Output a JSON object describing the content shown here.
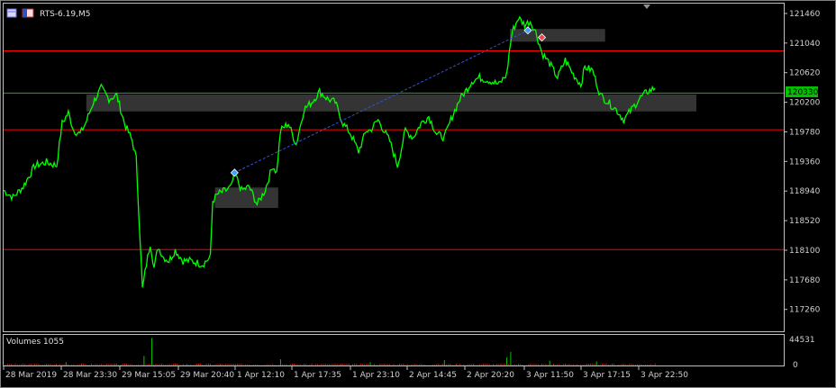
{
  "window": {
    "symbol_title": "RTS-6.19,M5",
    "volumes_label": "Volumes 1055",
    "current_price": "120330"
  },
  "colors": {
    "background": "#000000",
    "price_line": "#00ff00",
    "level_line": "#ff0000",
    "current_price_line": "#00c000",
    "zone_fill": "#3a3a3a",
    "volume_bars": "#cc2200",
    "axis_text": "#d0d0d0",
    "frame": "#c0c0c0",
    "trend_line": "#3355cc"
  },
  "chart_data": {
    "type": "line",
    "title": "RTS-6.19,M5",
    "x_tick_labels": [
      "28 Mar 2019",
      "28 Mar 23:30",
      "29 Mar 15:05",
      "29 Mar 20:40",
      "1 Apr 12:10",
      "1 Apr 17:35",
      "1 Apr 23:10",
      "2 Apr 14:45",
      "2 Apr 20:20",
      "3 Apr 11:50",
      "3 Apr 17:15",
      "3 Apr 22:50"
    ],
    "y_tick_labels": [
      "121460",
      "121040",
      "120620",
      "120200",
      "119780",
      "119360",
      "118940",
      "118520",
      "118100",
      "117680",
      "117260"
    ],
    "ylim": [
      116950,
      121600
    ],
    "current_price": 120330,
    "horizontal_levels": [
      120930,
      119810,
      118110
    ],
    "zones": [
      {
        "x_start": 0.106,
        "x_end": 0.888,
        "y_low": 120070,
        "y_high": 120310
      },
      {
        "x_start": 0.271,
        "x_end": 0.352,
        "y_low": 118700,
        "y_high": 118990
      },
      {
        "x_start": 0.649,
        "x_end": 0.771,
        "y_low": 121060,
        "y_high": 121240
      }
    ],
    "trend_line": {
      "x_start": 0.296,
      "y_start": 119200,
      "x_end": 0.672,
      "y_end": 121220
    },
    "series": [
      {
        "x": [
          0.0,
          0.012,
          0.025,
          0.04,
          0.055,
          0.068,
          0.075,
          0.083,
          0.09,
          0.098,
          0.105,
          0.115,
          0.125,
          0.135,
          0.145,
          0.155,
          0.165,
          0.17,
          0.178,
          0.183,
          0.188,
          0.193,
          0.198,
          0.205,
          0.212,
          0.22,
          0.23,
          0.24,
          0.255,
          0.265,
          0.268,
          0.275,
          0.285,
          0.292,
          0.296,
          0.305,
          0.315,
          0.325,
          0.335,
          0.345,
          0.35,
          0.355,
          0.365,
          0.375,
          0.385,
          0.395,
          0.405,
          0.415,
          0.425,
          0.435,
          0.445,
          0.455,
          0.465,
          0.47,
          0.48,
          0.495,
          0.505,
          0.515,
          0.525,
          0.535,
          0.545,
          0.555,
          0.565,
          0.575,
          0.585,
          0.595,
          0.6,
          0.61,
          0.625,
          0.635,
          0.645,
          0.648,
          0.652,
          0.66,
          0.668,
          0.675,
          0.682,
          0.69,
          0.7,
          0.71,
          0.72,
          0.73,
          0.74,
          0.745,
          0.755,
          0.765,
          0.775,
          0.785,
          0.795,
          0.805,
          0.815,
          0.825,
          0.835
        ],
        "y": [
          118950,
          118850,
          119000,
          119300,
          119350,
          119300,
          119900,
          120050,
          119800,
          119750,
          119900,
          120200,
          120400,
          120250,
          120300,
          119900,
          119650,
          119400,
          117550,
          117900,
          118200,
          117850,
          118150,
          118000,
          117950,
          118100,
          117950,
          117950,
          117900,
          118000,
          118800,
          118900,
          118950,
          119000,
          119200,
          118950,
          119000,
          118750,
          118950,
          119300,
          119200,
          119800,
          119900,
          119600,
          120100,
          120200,
          120350,
          120250,
          120200,
          119900,
          119750,
          119500,
          119800,
          119800,
          119950,
          119650,
          119300,
          119800,
          119700,
          119900,
          120000,
          119750,
          119700,
          120000,
          120250,
          120400,
          120500,
          120550,
          120500,
          120450,
          120600,
          120900,
          121200,
          121400,
          121300,
          121350,
          121200,
          120900,
          120750,
          120550,
          120800,
          120600,
          120450,
          120700,
          120650,
          120300,
          120200,
          120100,
          119950,
          120100,
          120250,
          120350,
          120400
        ]
      }
    ],
    "markers": [
      {
        "x": 0.296,
        "y": 119200,
        "kind": "buy"
      },
      {
        "x": 0.672,
        "y": 121220,
        "kind": "sell-open"
      },
      {
        "x": 0.69,
        "y": 121120,
        "kind": "sell-close"
      }
    ],
    "volume_panel": {
      "label": "Volumes 1055",
      "y_tick_labels": [
        "44531",
        "0"
      ],
      "ylim": [
        0,
        44531
      ],
      "spikes": [
        {
          "x": 0.19,
          "v": 40000
        },
        {
          "x": 0.18,
          "v": 14000
        },
        {
          "x": 0.355,
          "v": 9000
        },
        {
          "x": 0.65,
          "v": 20000
        },
        {
          "x": 0.645,
          "v": 12000
        },
        {
          "x": 0.565,
          "v": 8000
        },
        {
          "x": 0.7,
          "v": 7000
        },
        {
          "x": 0.76,
          "v": 6000
        },
        {
          "x": 0.08,
          "v": 5000
        },
        {
          "x": 0.47,
          "v": 5000
        }
      ]
    }
  }
}
